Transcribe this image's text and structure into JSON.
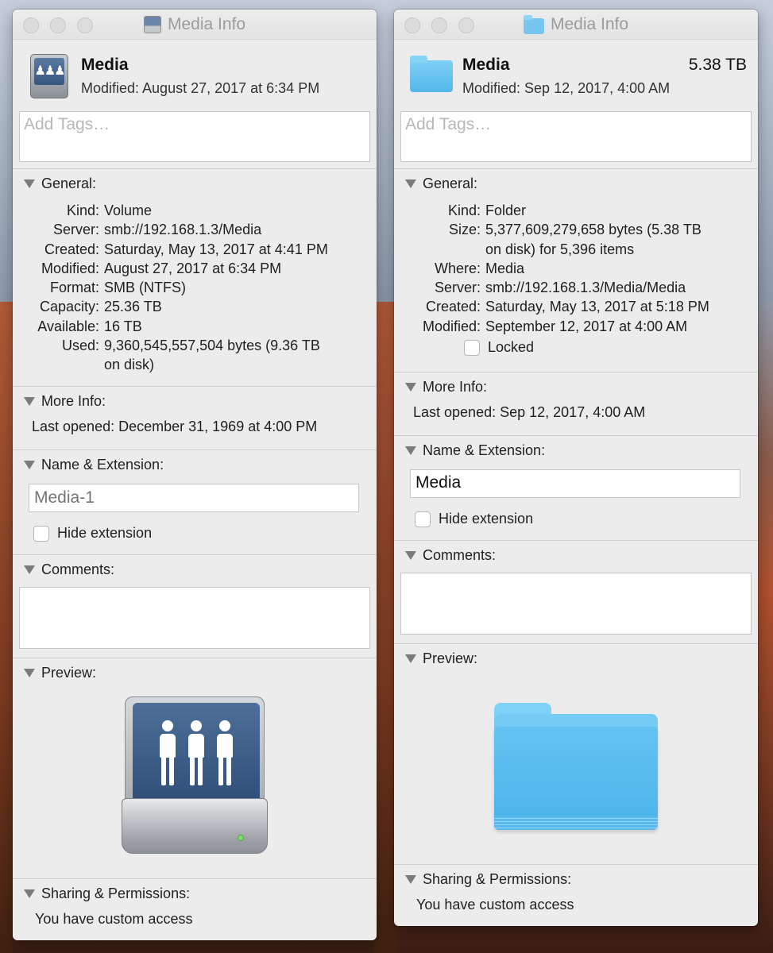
{
  "left": {
    "title": "Media Info",
    "name": "Media",
    "modified_line": "Modified: August 27, 2017 at 6:34 PM",
    "tags_placeholder": "Add Tags…",
    "general": {
      "heading": "General:",
      "rows": [
        {
          "k": "Kind:",
          "v": "Volume"
        },
        {
          "k": "Server:",
          "v": "smb://192.168.1.3/Media"
        },
        {
          "k": "Created:",
          "v": "Saturday, May 13, 2017 at 4:41 PM"
        },
        {
          "k": "Modified:",
          "v": "August 27, 2017 at 6:34 PM"
        },
        {
          "k": "Format:",
          "v": "SMB (NTFS)"
        },
        {
          "k": "Capacity:",
          "v": "25.36 TB"
        },
        {
          "k": "Available:",
          "v": "16 TB"
        },
        {
          "k": "Used:",
          "v": "9,360,545,557,504 bytes (9.36 TB",
          "v2": "on disk)"
        }
      ]
    },
    "more_info": {
      "heading": "More Info:",
      "k": "Last opened:",
      "v": "December 31, 1969 at 4:00 PM"
    },
    "name_ext": {
      "heading": "Name & Extension:",
      "placeholder": "Media-1",
      "value": "",
      "hide_ext_label": "Hide extension"
    },
    "comments": {
      "heading": "Comments:"
    },
    "preview": {
      "heading": "Preview:",
      "icon": "network-drive-icon"
    },
    "sharing": {
      "heading": "Sharing & Permissions:",
      "text": "You have custom access"
    }
  },
  "right": {
    "title": "Media Info",
    "name": "Media",
    "size": "5.38 TB",
    "modified_line": "Modified: Sep 12, 2017, 4:00 AM",
    "tags_placeholder": "Add Tags…",
    "general": {
      "heading": "General:",
      "rows": [
        {
          "k": "Kind:",
          "v": "Folder"
        },
        {
          "k": "Size:",
          "v": "5,377,609,279,658 bytes (5.38 TB",
          "v2": "on disk) for 5,396 items"
        },
        {
          "k": "Where:",
          "v": "Media"
        },
        {
          "k": "Server:",
          "v": "smb://192.168.1.3/Media/Media"
        },
        {
          "k": "Created:",
          "v": "Saturday, May 13, 2017 at 5:18 PM"
        },
        {
          "k": "Modified:",
          "v": "September 12, 2017 at 4:00 AM"
        }
      ],
      "locked_label": "Locked"
    },
    "more_info": {
      "heading": "More Info:",
      "k": "Last opened:",
      "v": "Sep 12, 2017, 4:00 AM"
    },
    "name_ext": {
      "heading": "Name & Extension:",
      "value": "Media",
      "hide_ext_label": "Hide extension"
    },
    "comments": {
      "heading": "Comments:"
    },
    "preview": {
      "heading": "Preview:",
      "icon": "folder-icon"
    },
    "sharing": {
      "heading": "Sharing & Permissions:",
      "text": "You have custom access"
    }
  },
  "colors": {
    "folder": "#5bbdef",
    "drive_face": "#3d5f8b",
    "window_bg": "#ececec"
  }
}
